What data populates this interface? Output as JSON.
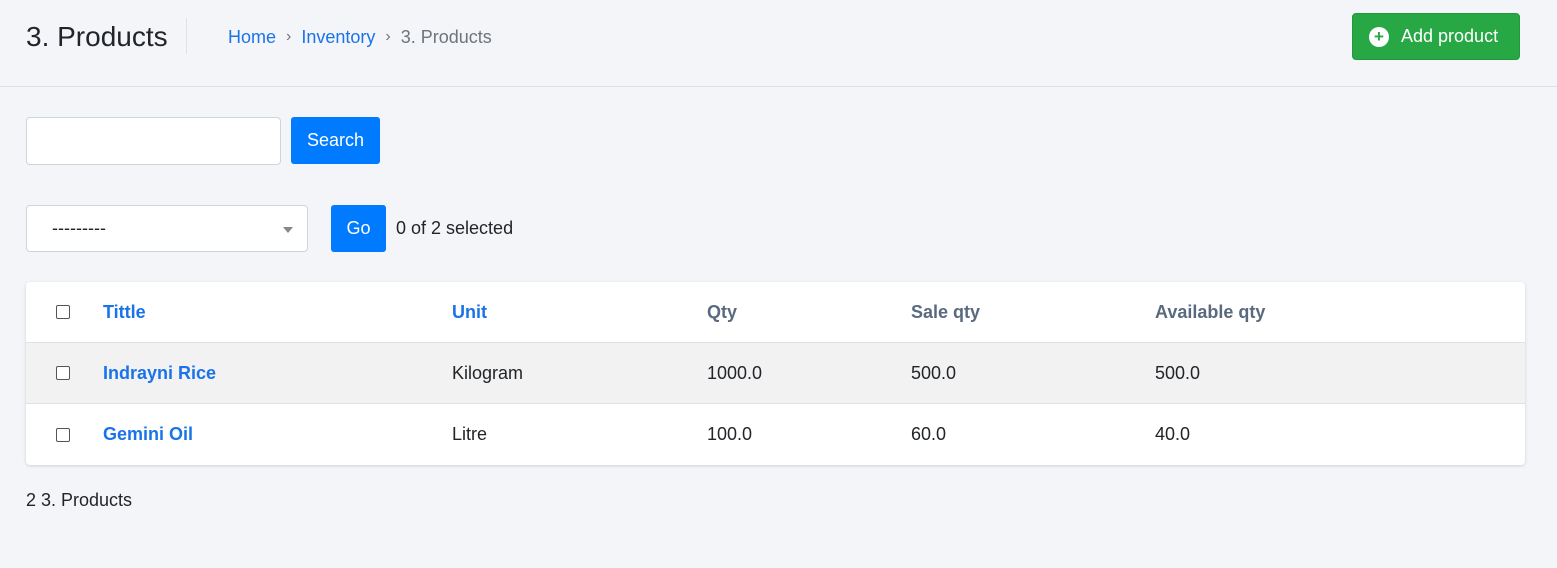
{
  "header": {
    "title": "3. Products",
    "breadcrumb": [
      {
        "label": "Home"
      },
      {
        "label": "Inventory"
      },
      {
        "label": "3. Products"
      }
    ],
    "breadcrumb_separator": "›",
    "add_button_label": "Add product",
    "add_button_icon": "plus-circle-icon"
  },
  "search": {
    "value": "",
    "placeholder": "",
    "button_label": "Search"
  },
  "actions": {
    "selected_option": "---------",
    "go_label": "Go",
    "selection_counter": "0 of 2 selected"
  },
  "table": {
    "columns": [
      "Tittle",
      "Unit",
      "Qty",
      "Sale qty",
      "Available qty"
    ],
    "rows": [
      {
        "title": "Indrayni Rice",
        "unit": "Kilogram",
        "qty": "1000.0",
        "sale_qty": "500.0",
        "available_qty": "500.0"
      },
      {
        "title": "Gemini Oil",
        "unit": "Litre",
        "qty": "100.0",
        "sale_qty": "60.0",
        "available_qty": "40.0"
      }
    ]
  },
  "footer": {
    "count_text": "2 3. Products"
  },
  "colors": {
    "primary": "#007bff",
    "success": "#28a745",
    "link": "#1a73e8",
    "background": "#f4f5f9"
  }
}
